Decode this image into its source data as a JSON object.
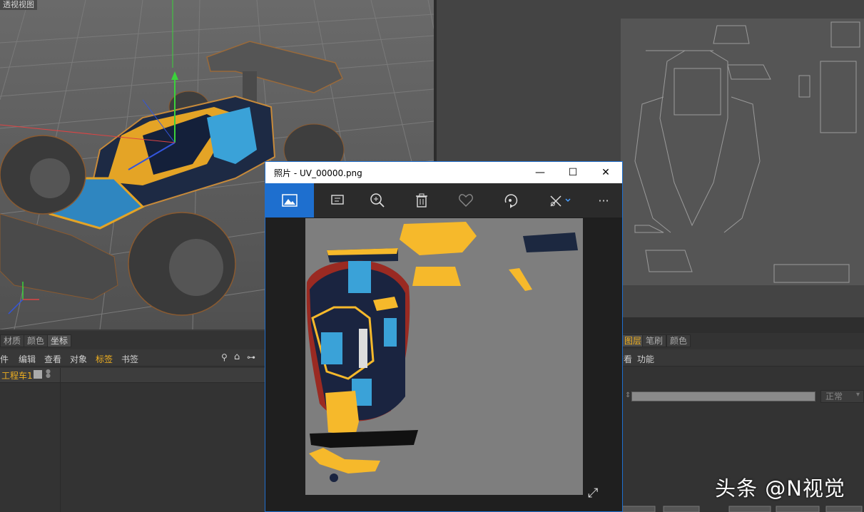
{
  "viewport": {
    "title": "透视视图"
  },
  "left_panel": {
    "tabs": [
      "材质",
      "颜色",
      "坐标"
    ],
    "menu": [
      "文件",
      "编辑",
      "查看",
      "对象",
      "标签",
      "书签"
    ],
    "object_name": "工程车1"
  },
  "right_panel": {
    "tabs": [
      "图层",
      "笔刷",
      "颜色"
    ],
    "menu": [
      "查看",
      "功能"
    ],
    "blend_mode": "正常"
  },
  "photos_window": {
    "title": "照片 - UV_00000.png",
    "toolbar": [
      "image-icon",
      "slideshow-icon",
      "zoom-in-icon",
      "delete-icon",
      "heart-icon",
      "rotate-icon",
      "edit-icon",
      "more-icon"
    ],
    "accent_color": "#1e6fcf"
  },
  "watermark": "头条 @N视觉"
}
